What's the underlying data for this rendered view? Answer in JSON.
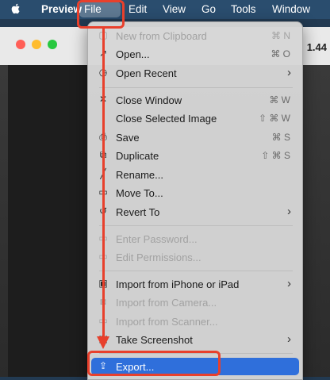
{
  "menubar": {
    "app": "Preview",
    "items": [
      "File",
      "Edit",
      "View",
      "Go",
      "Tools",
      "Window"
    ]
  },
  "background_window": {
    "zoom_fragment": "1.44"
  },
  "file_menu": {
    "items": [
      {
        "label": "New from Clipboard",
        "shortcut": "⌘ N",
        "icon": "clipboard-icon",
        "disabled": true
      },
      {
        "label": "Open...",
        "shortcut": "⌘ O",
        "icon": "open-arrow-icon"
      },
      {
        "label": "Open Recent",
        "submenu": true,
        "icon": "clock-icon"
      },
      {
        "label": "Close Window",
        "shortcut": "⌘ W",
        "icon": "close-icon"
      },
      {
        "label": "Close Selected Image",
        "shortcut": "⇧ ⌘ W"
      },
      {
        "label": "Save",
        "shortcut": "⌘ S",
        "icon": "save-icon"
      },
      {
        "label": "Duplicate",
        "shortcut": "⇧ ⌘ S",
        "icon": "duplicate-icon"
      },
      {
        "label": "Rename...",
        "icon": "pencil-icon"
      },
      {
        "label": "Move To...",
        "icon": "folder-icon"
      },
      {
        "label": "Revert To",
        "submenu": true,
        "icon": "revert-icon"
      },
      {
        "label": "Enter Password...",
        "icon": "password-icon",
        "disabled": true
      },
      {
        "label": "Edit Permissions...",
        "icon": "permissions-icon",
        "disabled": true
      },
      {
        "label": "Import from iPhone or iPad",
        "submenu": true,
        "icon": "device-icon"
      },
      {
        "label": "Import from Camera...",
        "icon": "camera-icon",
        "disabled": true
      },
      {
        "label": "Import from Scanner...",
        "icon": "scanner-icon",
        "disabled": true
      },
      {
        "label": "Take Screenshot",
        "submenu": true,
        "icon": "screenshot-icon"
      },
      {
        "label": "Export...",
        "icon": "export-icon",
        "selected": true
      }
    ]
  },
  "colors": {
    "selection": "#2f6fdb",
    "annotation": "#e8402c"
  }
}
